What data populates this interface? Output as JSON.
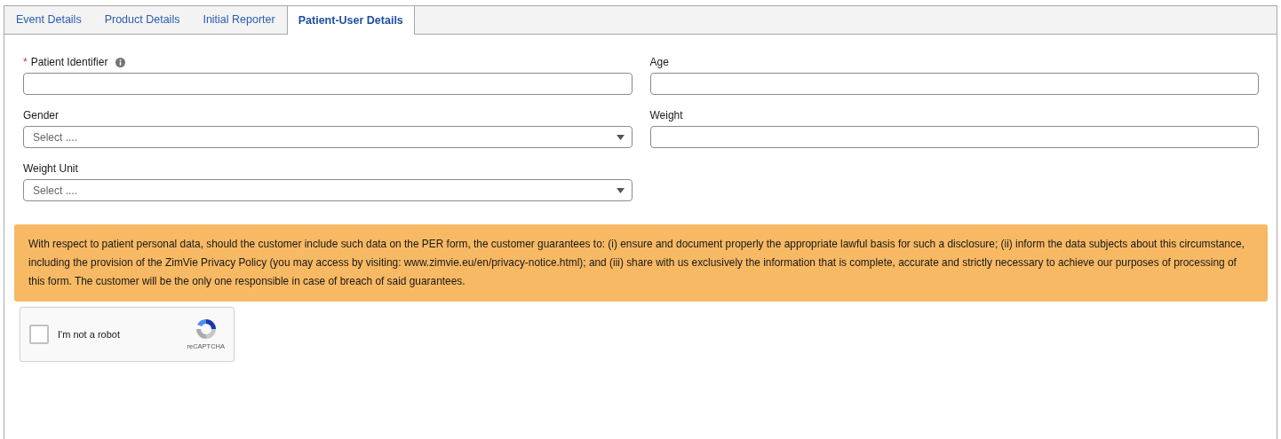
{
  "tabs": [
    {
      "label": "Event Details",
      "selected": false
    },
    {
      "label": "Product Details",
      "selected": false
    },
    {
      "label": "Initial Reporter",
      "selected": false
    },
    {
      "label": "Patient-User Details",
      "selected": true
    }
  ],
  "fields": [
    {
      "kind": "text",
      "label": "Patient Identifier",
      "required_mark": "*",
      "info": true
    },
    {
      "kind": "text",
      "label": "Age",
      "info": false
    },
    {
      "kind": "select",
      "label": "Gender",
      "placeholder": "Select ....",
      "info": false
    },
    {
      "kind": "text",
      "label": "Weight",
      "info": false
    },
    {
      "kind": "select",
      "label": "Weight Unit",
      "placeholder": "Select ....",
      "info": false
    }
  ],
  "notice": "With respect to patient personal data, should the customer include such data on the PER form, the customer guarantees to: (i) ensure and document properly the appropriate lawful basis for such a disclosure; (ii) inform the data subjects about this circumstance, including the provision of the ZimVie Privacy Policy (you may access by visiting: www.zimvie.eu/en/privacy-notice.html); and (iii) share with us exclusively the information that is complete, accurate and strictly necessary to achieve our purposes of processing of this form. The customer will be the only one responsible in case of breach of said guarantees.",
  "captcha": {
    "checked": false,
    "label": "I'm not a robot",
    "brand": "reCAPTCHA"
  }
}
